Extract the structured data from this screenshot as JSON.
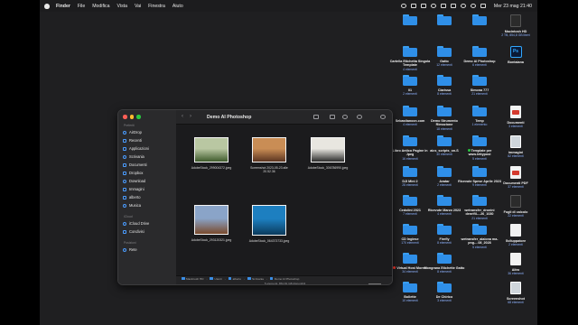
{
  "menubar": {
    "app": "Finder",
    "menus": [
      "File",
      "Modifica",
      "Vista",
      "Vai",
      "Finestra",
      "Aiuto"
    ],
    "clock": "Mer 23 mag  21:40"
  },
  "desktop": [
    {
      "name": "",
      "count": "",
      "type": "folder"
    },
    {
      "name": "",
      "count": "",
      "type": "folder"
    },
    {
      "name": "",
      "count": "",
      "type": "folder"
    },
    {
      "name": "Macintosh HD",
      "count": "2 TB, 854,8 GB liberi",
      "type": "drive"
    },
    {
      "name": "Cartella Etichetta Singola Template",
      "count": "4 elementi",
      "type": "folder"
    },
    {
      "name": "Gatto",
      "count": "12 elementi",
      "type": "folder"
    },
    {
      "name": "Demo AI Photoshop",
      "count": "6 elementi",
      "type": "folder"
    },
    {
      "name": "Bontaiana",
      "count": "",
      "type": "ps"
    },
    {
      "name": "01",
      "count": "2 elementi",
      "type": "folder"
    },
    {
      "name": "Clarissa",
      "count": "8 elementi",
      "type": "folder"
    },
    {
      "name": "Simona 777",
      "count": "21 elementi",
      "type": "folder"
    },
    {
      "name": "",
      "count": "",
      "type": "blank"
    },
    {
      "name": "Sebastianocn.com",
      "count": "4 elementi",
      "type": "folder"
    },
    {
      "name": "Demo Strumento Rimozione",
      "count": "18 elementi",
      "type": "folder"
    },
    {
      "name": "Temp",
      "count": "1 elemento",
      "type": "folder"
    },
    {
      "name": "Documenti",
      "count": "3 elementi",
      "type": "docred"
    },
    {
      "name": "Libro Antico Pagine in Jpeg",
      "count": "16 elementi",
      "type": "folder"
    },
    {
      "name": "aics_scripts_on-S",
      "count": "30 elementi",
      "type": "folder"
    },
    {
      "name": "Template per www.lettypost",
      "count": "5 elementi",
      "type": "folder",
      "tag": "#28c840"
    },
    {
      "name": "immagini",
      "count": "82 elementi",
      "type": "photo"
    },
    {
      "name": "DJI Mini 2",
      "count": "28 elementi",
      "type": "folder"
    },
    {
      "name": "Avatar",
      "count": "2 elementi",
      "type": "folder"
    },
    {
      "name": "Ricevute Spese Aprile 2023",
      "count": "9 elementi",
      "type": "folder"
    },
    {
      "name": "Documenti PDF",
      "count": "37 elementi",
      "type": "docred"
    },
    {
      "name": "Cedolini 2021",
      "count": "7 elementi",
      "type": "folder"
    },
    {
      "name": "Ricevute Marzo 2023",
      "count": "4 elementi",
      "type": "folder"
    },
    {
      "name": "wetransfer_dronini denrifil-...26_1030",
      "count": "21 elementi",
      "type": "folder"
    },
    {
      "name": "Fogli di calcolo",
      "count": "22 elementi",
      "type": "dark"
    },
    {
      "name": "CD Inglese",
      "count": "170 elementi",
      "type": "folder"
    },
    {
      "name": "Firefly",
      "count": "8 elementi",
      "type": "folder"
    },
    {
      "name": "wetransfer_alaiona ma-png-...08_2028",
      "count": "5 elementi",
      "type": "folder"
    },
    {
      "name": "Sviluppatore",
      "count": "2 elementi",
      "type": "doc"
    },
    {
      "name": "Virtual Host Moresi",
      "count": "34 elementi",
      "type": "folder",
      "tag": "#ff3b30"
    },
    {
      "name": "Mongrana Etichette Gatto",
      "count": "8 elementi",
      "type": "folder"
    },
    {
      "name": "",
      "count": "",
      "type": "blank"
    },
    {
      "name": "Altro",
      "count": "36 elementi",
      "type": "doc"
    },
    {
      "name": "Bollette",
      "count": "10 elementi",
      "type": "folder"
    },
    {
      "name": "De Chirico",
      "count": "3 elementi",
      "type": "folder"
    },
    {
      "name": "",
      "count": "",
      "type": "blank"
    },
    {
      "name": "Screenshot",
      "count": "68 elementi",
      "type": "photo"
    }
  ],
  "finder": {
    "title": "Demo AI Photoshop",
    "sidebar_sections": [
      {
        "header": "Preferiti",
        "items": [
          "AirDrop",
          "Recenti",
          "Applicazioni",
          "Scrivania",
          "Documenti",
          "Dropbox",
          "Download",
          "Immagini",
          "alberto",
          "Musica"
        ]
      },
      {
        "header": "iCloud",
        "items": [
          "iCloud Drive",
          "Condivisi"
        ]
      },
      {
        "header": "Posizioni",
        "items": [
          "Rete"
        ]
      }
    ],
    "files": [
      {
        "name": "AdobeStock_299004372.jpeg",
        "colors": [
          "#b9c7a2",
          "#3f5b2c"
        ]
      },
      {
        "name": "Screenshot 2023-05-23 alle 20.52.36",
        "colors": [
          "#c98d55",
          "#5a3420"
        ]
      },
      {
        "name": "AdobeStock_306786990.jpeg",
        "colors": [
          "#e8e6e0",
          "#2b2b2b"
        ]
      },
      {
        "name": "AdobeStock_293120321.jpeg",
        "colors": [
          "#8aa4c8",
          "#7a4a2c"
        ]
      },
      {
        "name": "AdobeStock_064373733.jpeg",
        "colors": [
          "#1d7fc0",
          "#0b3a5c"
        ]
      }
    ],
    "path": [
      "Macintosh HD",
      "Utenti",
      "alberto",
      "Scrivania",
      "Demo AI Photoshop"
    ],
    "status": "5 elementi, 854,81 GB disponibili"
  }
}
